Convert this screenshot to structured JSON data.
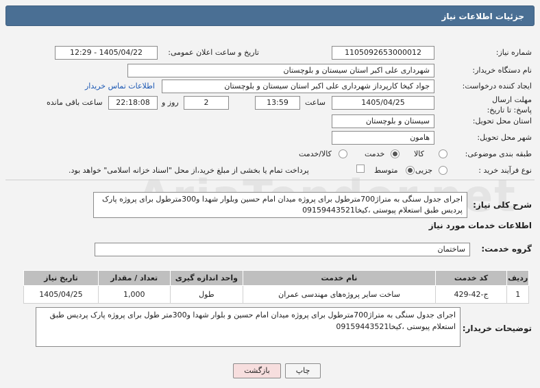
{
  "header": {
    "title": "جزئیات اطلاعات نیاز"
  },
  "form": {
    "need_number_label": "شماره نیاز:",
    "need_number": "1105092653000012",
    "announce_label": "تاریخ و ساعت اعلان عمومی:",
    "announce_value": "1405/04/22 - 12:29",
    "buyer_org_label": "نام دستگاه خریدار:",
    "buyer_org": "شهرداری علی اکبر استان سیستان و بلوچستان",
    "requester_label": "ایجاد کننده درخواست:",
    "requester": "جواد کیخا کارپرداز شهرداری علی اکبر استان سیستان و بلوچستان",
    "contact_link": "اطلاعات تماس خریدار",
    "deadline_label": "مهلت ارسال پاسخ: تا تاریخ:",
    "deadline_date": "1405/04/25",
    "time_label": "ساعت",
    "deadline_time": "13:59",
    "days_value": "2",
    "days_label": "روز و",
    "remaining_time": "22:18:08",
    "remaining_label": "ساعت باقی مانده",
    "province_label": "استان محل تحویل:",
    "province": "سیستان و بلوچستان",
    "city_label": "شهر محل تحویل:",
    "city": "هامون",
    "category_label": "طبقه بندی موضوعی:",
    "category_options": [
      "کالا",
      "خدمت",
      "کالا/خدمت"
    ],
    "category_selected": "خدمت",
    "process_label": "نوع فرآیند خرید :",
    "process_options": [
      "جزیی",
      "متوسط"
    ],
    "process_selected": "متوسط",
    "payment_note": "پرداخت تمام یا بخشی از مبلغ خرید،از محل \"اسناد خزانه اسلامی\" خواهد بود."
  },
  "description": {
    "label": "شرح کلی نیاز:",
    "text": "اجرای جدول سنگی به متراژ700مترطول برای پروژه میدان امام حسین وبلوار شهدا و300مترطول برای پروژه پارک پردیس طبق استعلام پیوستی ،کیخا09159443521"
  },
  "services": {
    "section_title": "اطلاعات خدمات مورد نیاز",
    "group_label": "گروه خدمت:",
    "group_value": "ساختمان",
    "columns": [
      "ردیف",
      "کد خدمت",
      "نام خدمت",
      "واحد اندازه گیری",
      "تعداد / مقدار",
      "تاریخ نیاز"
    ],
    "rows": [
      {
        "index": "1",
        "code": "ج-42-429",
        "name": "ساخت سایر پروژه‌های مهندسی عمران",
        "unit": "طول",
        "qty": "1,000",
        "date": "1405/04/25"
      }
    ]
  },
  "buyer_notes": {
    "label": "توضیحات خریدار:",
    "text": "اجرای جدول سنگی به متراژ700مترطول برای پروژه میدان امام حسین و بلوار شهدا و300متر طول برای پروژه پارک پردیس طبق استعلام پیوستی ،کیخا09159443521"
  },
  "buttons": {
    "print": "چاپ",
    "back": "بازگشت"
  },
  "watermark": "AriaTender.net"
}
